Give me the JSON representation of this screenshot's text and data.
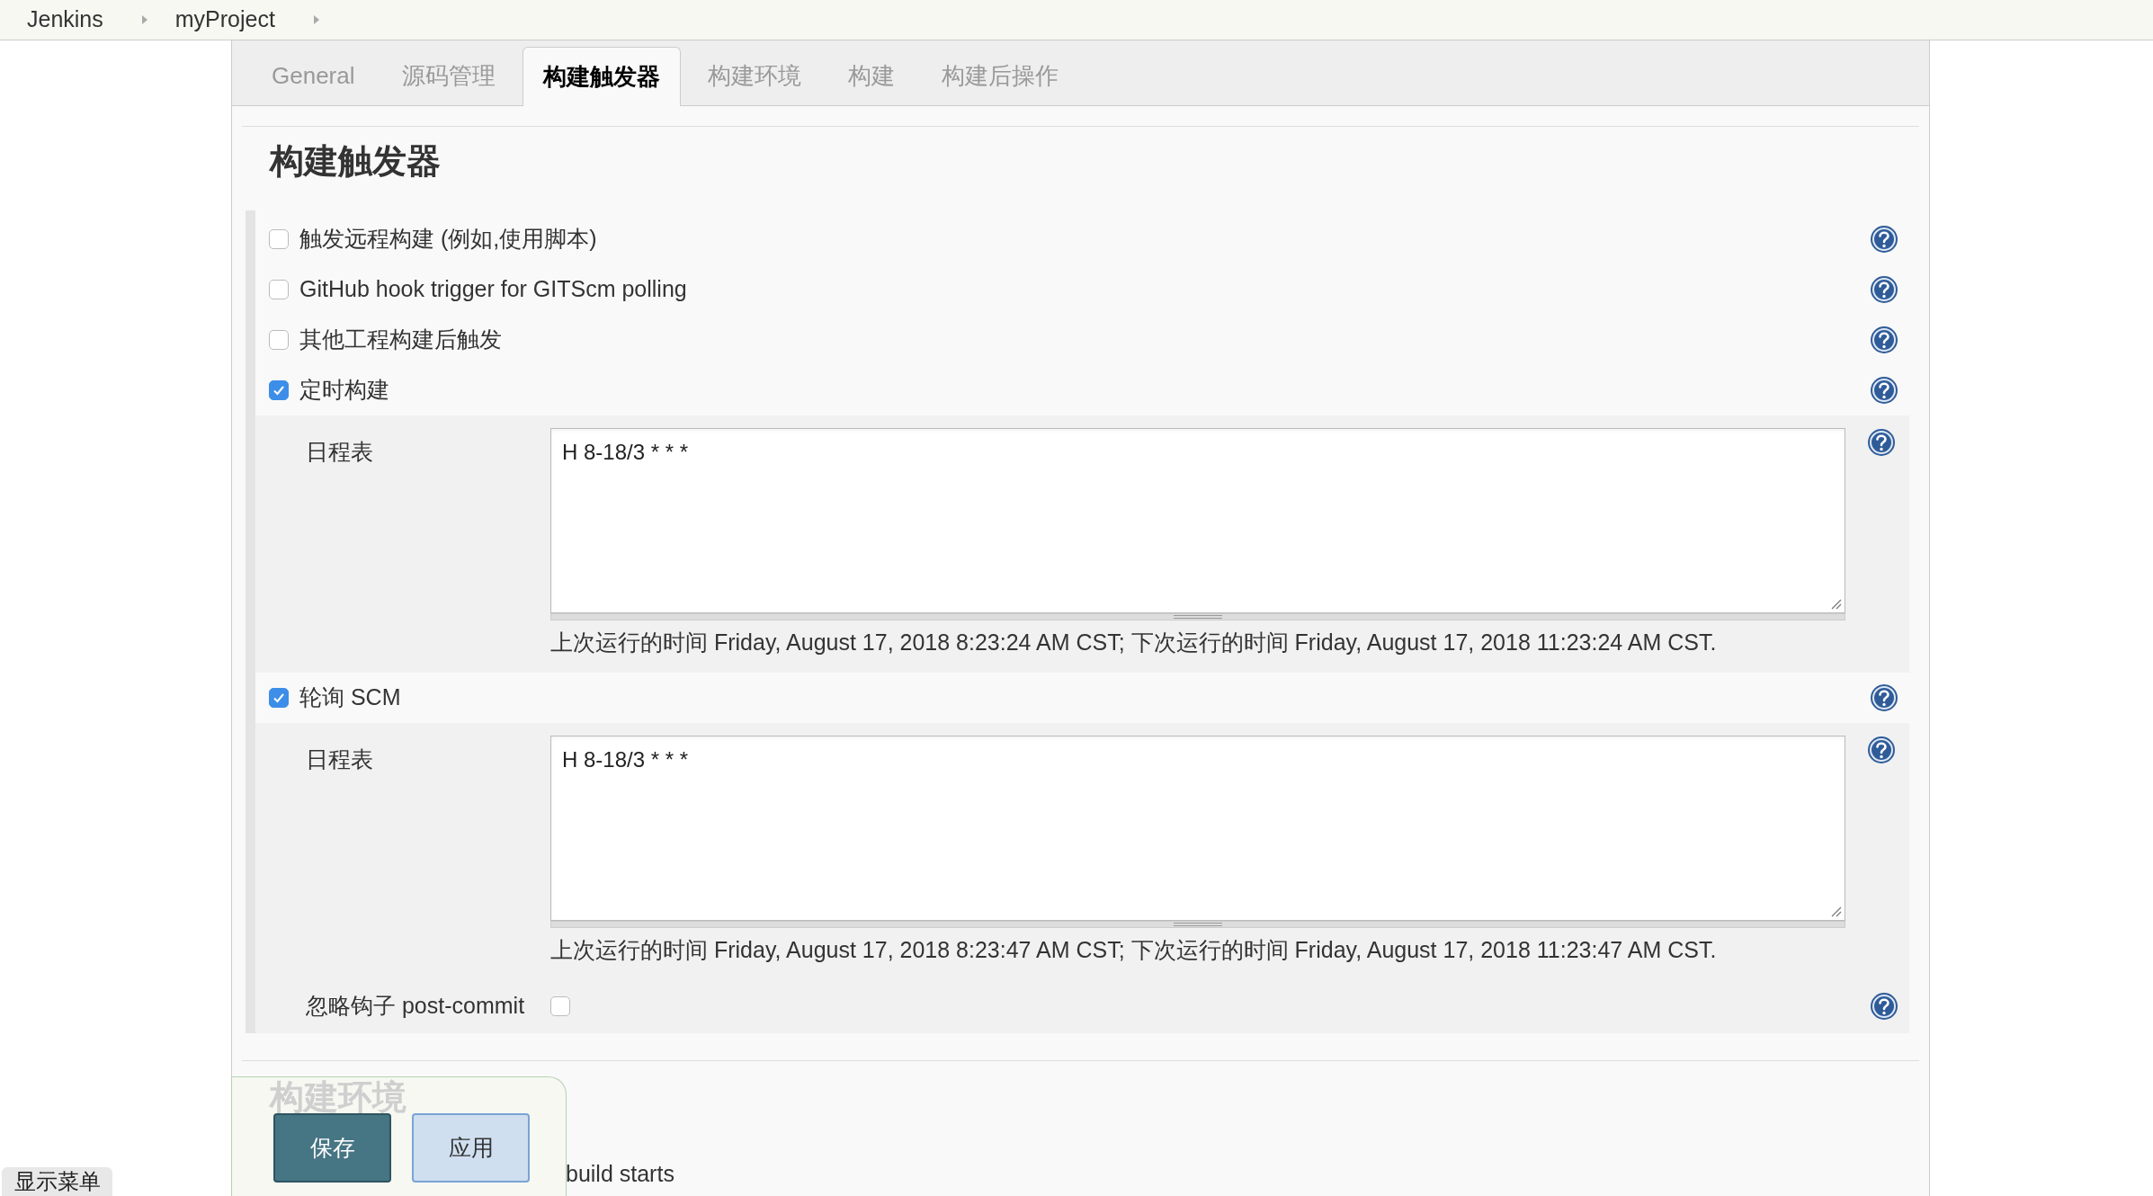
{
  "breadcrumbs": [
    {
      "label": "Jenkins"
    },
    {
      "label": "myProject"
    }
  ],
  "tabs": [
    {
      "label": "General",
      "selected": false
    },
    {
      "label": "源码管理",
      "selected": false
    },
    {
      "label": "构建触发器",
      "selected": true
    },
    {
      "label": "构建环境",
      "selected": false
    },
    {
      "label": "构建",
      "selected": false
    },
    {
      "label": "构建后操作",
      "selected": false
    }
  ],
  "section": {
    "title": "构建触发器",
    "triggers": [
      {
        "label": "触发远程构建 (例如,使用脚本)",
        "checked": false
      },
      {
        "label": "GitHub hook trigger for GITScm polling",
        "checked": false
      },
      {
        "label": "其他工程构建后触发",
        "checked": false
      },
      {
        "label": "定时构建",
        "checked": true,
        "schedule": {
          "label": "日程表",
          "value": "H 8-18/3 * * *",
          "note": "上次运行的时间 Friday, August 17, 2018 8:23:24 AM CST; 下次运行的时间 Friday, August 17, 2018 11:23:24 AM CST."
        }
      },
      {
        "label": "轮询 SCM",
        "checked": true,
        "schedule": {
          "label": "日程表",
          "value": "H 8-18/3 * * *",
          "note": "上次运行的时间 Friday, August 17, 2018 8:23:47 AM CST; 下次运行的时间 Friday, August 17, 2018 11:23:47 AM CST."
        },
        "ignore_hook": {
          "label": "忽略钩子 post-commit",
          "checked": false
        }
      }
    ]
  },
  "next_section": {
    "title": "构建环境",
    "option_text": "build starts"
  },
  "buttons": [
    {
      "label": "保存",
      "kind": "primary"
    },
    {
      "label": "应用",
      "kind": "secondary"
    }
  ],
  "show_menu": "显示菜单"
}
